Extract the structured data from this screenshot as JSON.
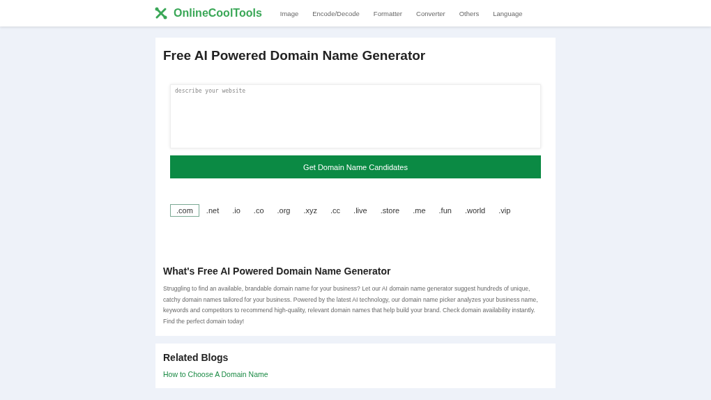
{
  "header": {
    "logo": "OnlineCoolTools",
    "nav": [
      "Image",
      "Encode/Decode",
      "Formatter",
      "Converter",
      "Others",
      "Language"
    ]
  },
  "tool": {
    "title": "Free AI Powered Domain Name Generator",
    "input": {
      "placeholder": "describe your website"
    },
    "button": "Get Domain Name Candidates",
    "tlds": [
      {
        "label": ".com",
        "selected": true
      },
      {
        "label": ".net",
        "selected": false
      },
      {
        "label": ".io",
        "selected": false
      },
      {
        "label": ".co",
        "selected": false
      },
      {
        "label": ".org",
        "selected": false
      },
      {
        "label": ".xyz",
        "selected": false
      },
      {
        "label": ".cc",
        "selected": false
      },
      {
        "label": ".live",
        "selected": false
      },
      {
        "label": ".store",
        "selected": false
      },
      {
        "label": ".me",
        "selected": false
      },
      {
        "label": ".fun",
        "selected": false
      },
      {
        "label": ".world",
        "selected": false
      },
      {
        "label": ".vip",
        "selected": false
      }
    ],
    "about_heading": "What's Free AI Powered Domain Name Generator",
    "about_text": "Struggling to find an available, brandable domain name for your business? Let our AI domain name generator suggest hundreds of unique, catchy domain names tailored for your business. Powered by the latest AI technology, our domain name picker analyzes your business name, keywords and competitors to recommend high-quality, relevant domain names that help build your brand. Check domain availability instantly. Find the perfect domain today!"
  },
  "related": {
    "heading": "Related Blogs",
    "links": [
      "How to Choose A Domain Name"
    ]
  }
}
